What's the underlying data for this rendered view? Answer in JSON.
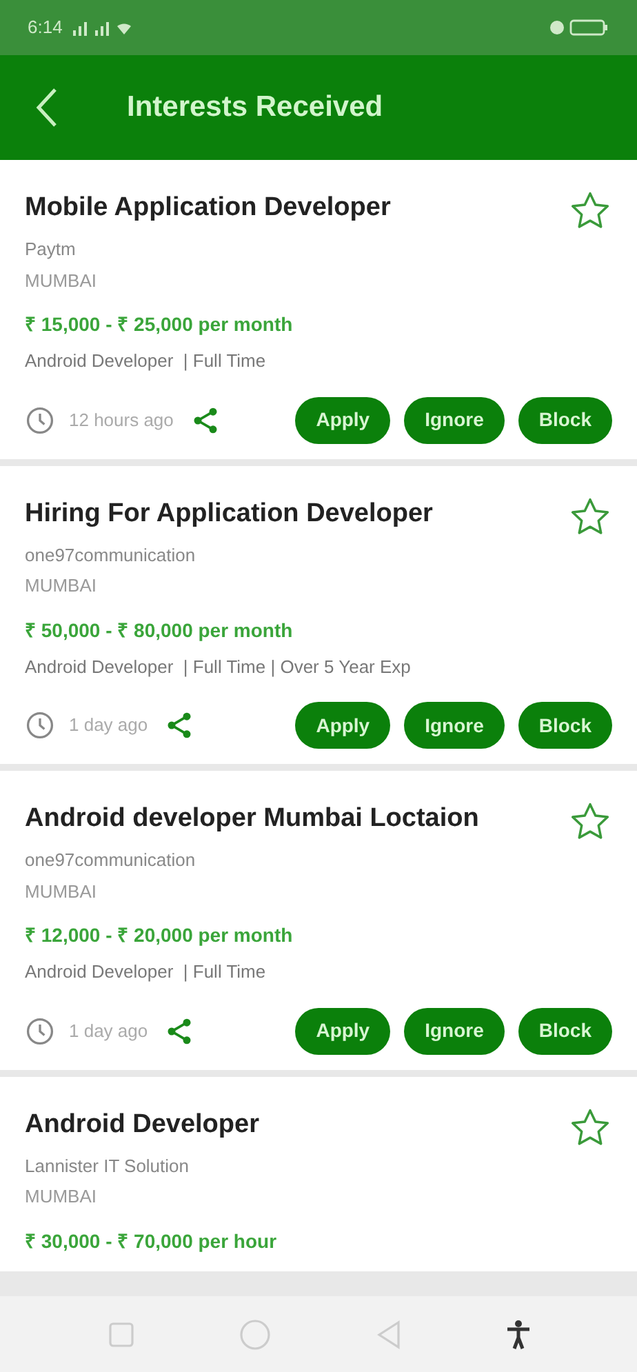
{
  "status_bar": {
    "time": "6:14"
  },
  "header": {
    "title": "Interests Received"
  },
  "jobs": [
    {
      "title": "Mobile Application Developer",
      "company": "Paytm",
      "city": "MUMBAI",
      "salary": "₹ 15,000 - ₹ 25,000 per month",
      "tags": "Android Developer  | Full Time",
      "posted": "12 hours ago",
      "starred": false,
      "actions": [
        "Apply",
        "Ignore",
        "Block"
      ]
    },
    {
      "title": "Hiring For Application Developer",
      "company": "one97communication",
      "city": "MUMBAI",
      "salary": "₹ 50,000 - ₹ 80,000 per month",
      "tags": "Android Developer  | Full Time | Over 5 Year Exp",
      "posted": "1 day ago",
      "starred": false,
      "actions": [
        "Apply",
        "Ignore",
        "Block"
      ]
    },
    {
      "title": "Android developer Mumbai Loctaion",
      "company": "one97communication",
      "city": "MUMBAI",
      "salary": "₹ 12,000 - ₹ 20,000 per month",
      "tags": "Android Developer  | Full Time",
      "posted": "1 day ago",
      "starred": false,
      "actions": [
        "Apply",
        "Ignore",
        "Block"
      ]
    },
    {
      "title": "Android Developer",
      "company": "Lannister IT Solution",
      "city": "MUMBAI",
      "salary": "₹ 30,000 - ₹ 70,000 per hour",
      "starred": false
    }
  ]
}
